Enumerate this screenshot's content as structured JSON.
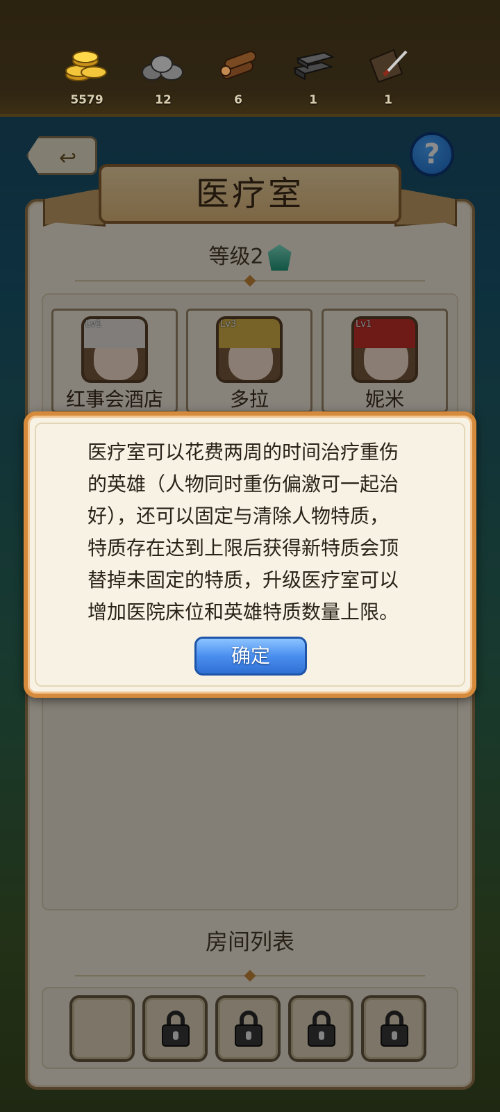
{
  "resources": [
    {
      "icon": "gold-coins-icon",
      "value": "5579"
    },
    {
      "icon": "stone-icon",
      "value": "12"
    },
    {
      "icon": "wood-logs-icon",
      "value": "6"
    },
    {
      "icon": "iron-ingot-icon",
      "value": "1"
    },
    {
      "icon": "leather-knife-icon",
      "value": "1"
    }
  ],
  "header": {
    "title": "医疗室",
    "level_label": "等级2"
  },
  "heroes": [
    {
      "name": "红事会酒店",
      "level": "Lv1"
    },
    {
      "name": "多拉",
      "level": "Lv3"
    },
    {
      "name": "妮米",
      "level": "Lv1"
    }
  ],
  "rooms": {
    "title": "房间列表",
    "slots": [
      "empty",
      "locked",
      "locked",
      "locked",
      "locked"
    ]
  },
  "dialog": {
    "message": "医疗室可以花费两周的时间治疗重伤\n的英雄（人物同时重伤偏激可一起治\n好），还可以固定与清除人物特质，\n特质存在达到上限后获得新特质会顶\n替掉未固定的特质，升级医疗室可以\n增加医院床位和英雄特质数量上限。",
    "confirm_label": "确定"
  },
  "colors": {
    "dialog_border": "#d58a3c",
    "confirm_button": "#4a8ff0",
    "panel_bg": "#f6efe0"
  }
}
